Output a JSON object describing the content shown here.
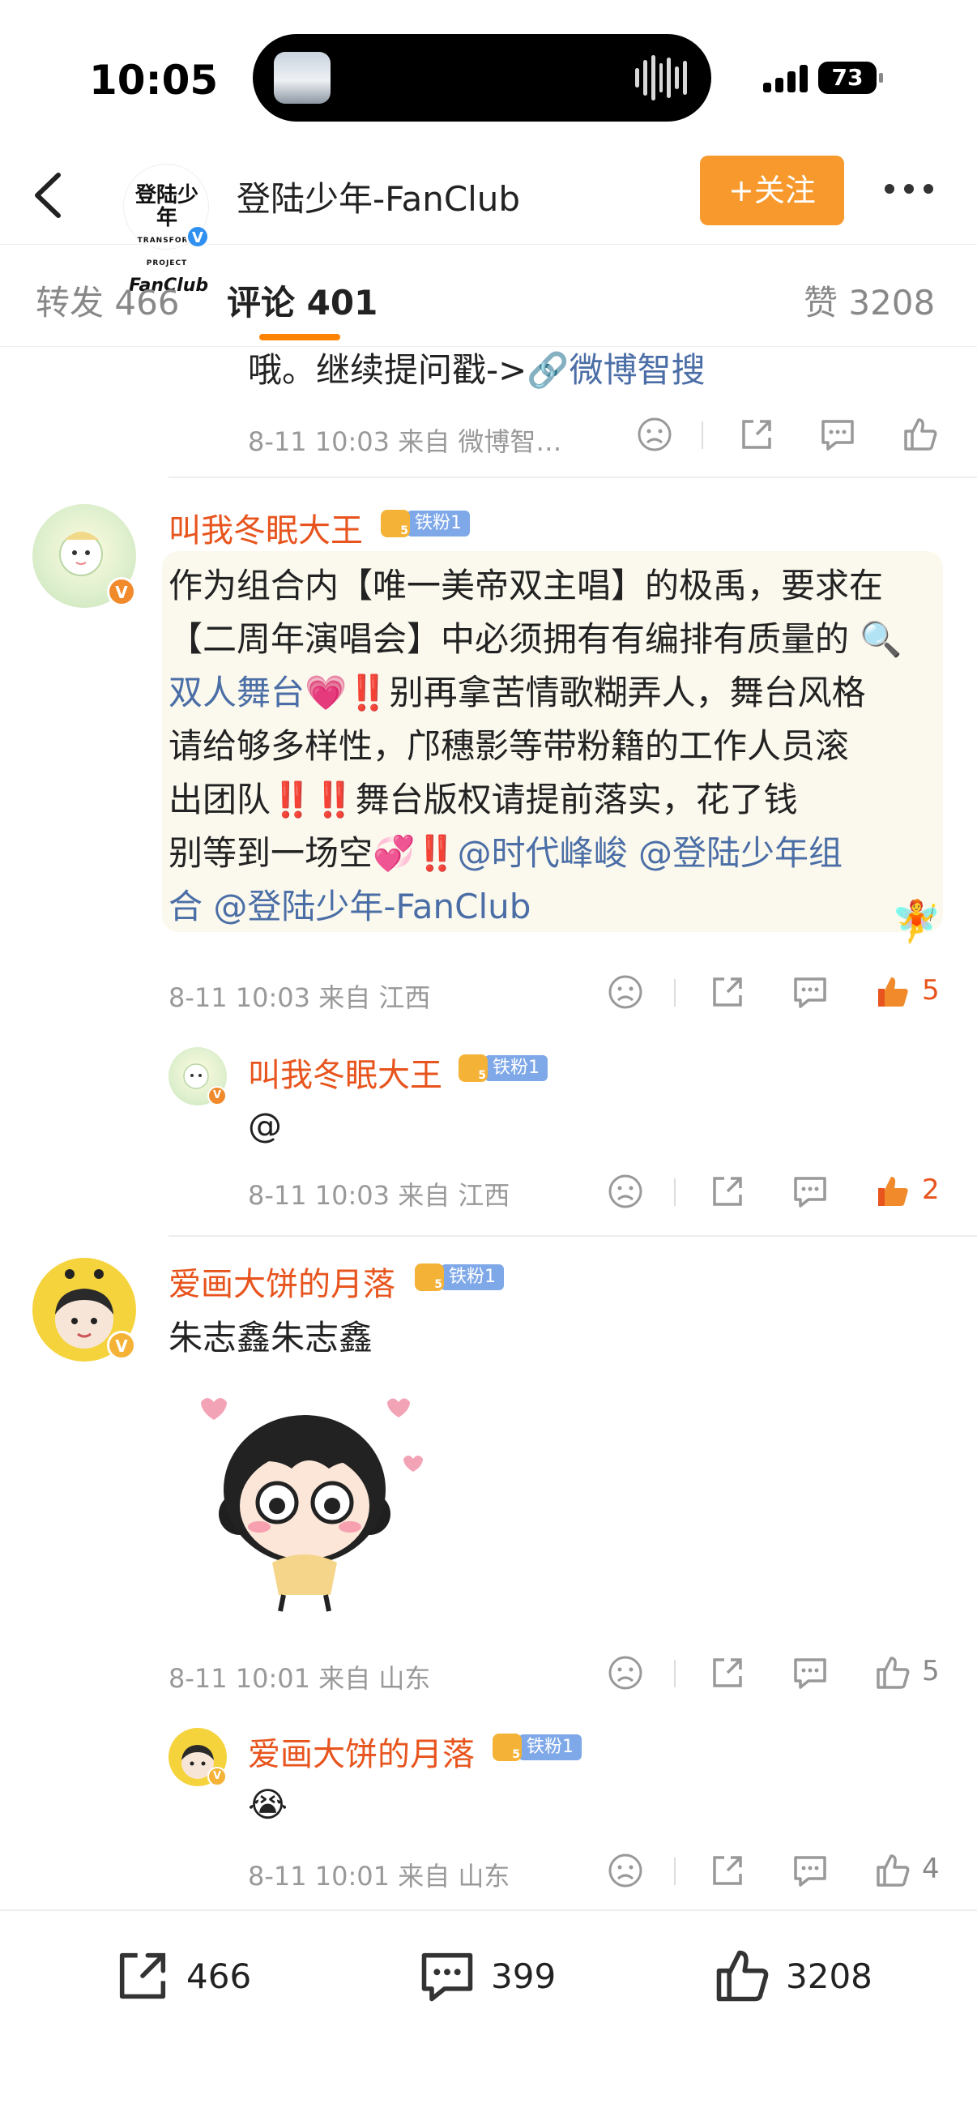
{
  "status_bar": {
    "time": "10:05",
    "battery": "73"
  },
  "header": {
    "logo_line1": "登陆少年",
    "logo_line2": "TRANSFORM PROJECT",
    "logo_line3": "FanClub",
    "title": "登陆少年-FanClub",
    "follow_label": "+关注"
  },
  "tabs": {
    "repost": "转发 466",
    "comments": "评论 401",
    "likes": "赞 3208"
  },
  "top_partial": {
    "text_prefix": "哦。继续提问戳->",
    "link_text": "微博智搜",
    "meta": "8-11 10:03  来自 微博智…"
  },
  "comment1": {
    "name": "叫我冬眠大王",
    "fan_label": "铁粉1",
    "line1": "作为组合内【唯一美帝双主唱】的极禹，要求在",
    "line2a": "【二周年演唱会】中必须拥有有编排有质量的",
    "line3_link": "双人舞台",
    "line3b": "💗‼️别再拿苦情歌糊弄人，舞台风格",
    "line4": "请给够多样性，邝穗影等带粉籍的工作人员滚",
    "line5": "出团队‼️‼️舞台版权请提前落实，花了钱",
    "line6a": "别等到一场空💞‼️",
    "line6_mentions": "@时代峰峻 @登陆少年组",
    "line7_mentions": "合 @登陆少年-FanClub",
    "meta": "8-11 10:03  来自 江西",
    "likes": "5"
  },
  "reply1": {
    "name": "叫我冬眠大王",
    "fan_label": "铁粉1",
    "text": "@",
    "meta": "8-11 10:03  来自 江西",
    "likes": "2"
  },
  "comment2": {
    "name": "爱画大饼的月落",
    "fan_label": "铁粉1",
    "text": "朱志鑫朱志鑫",
    "meta": "8-11 10:01  来自 山东",
    "likes": "5"
  },
  "reply2": {
    "name": "爱画大饼的月落",
    "fan_label": "铁粉1",
    "text": "😭",
    "meta": "8-11 10:01  来自 山东",
    "likes": "4"
  },
  "bottom_bar": {
    "reposts": "466",
    "comments": "399",
    "likes": "3208"
  },
  "colors": {
    "accent": "#ff8200",
    "follow_button": "#f7992d",
    "username": "#e8541d",
    "link": "#4b6ea6"
  }
}
